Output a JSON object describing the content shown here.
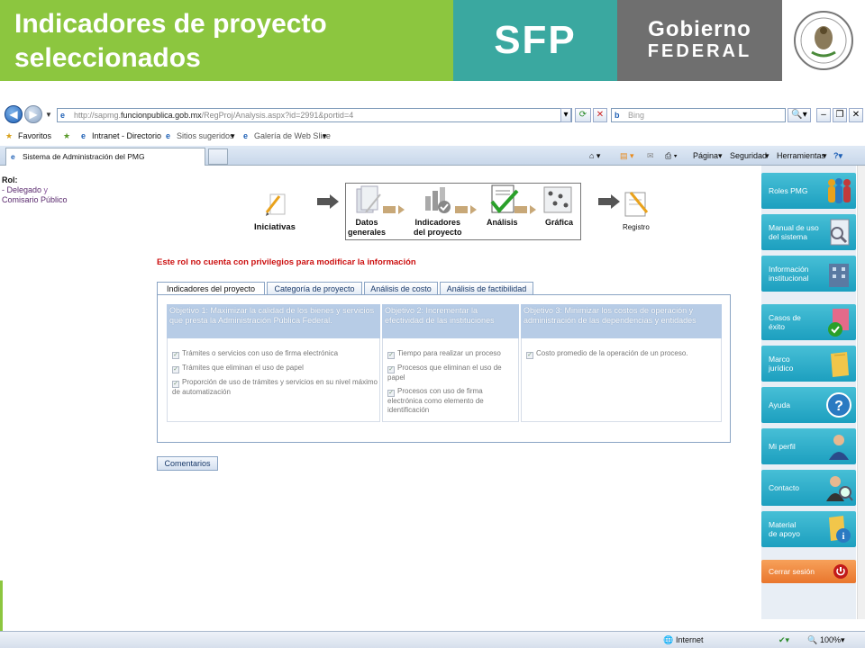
{
  "slide": {
    "title_line1": "Indicadores de proyecto",
    "title_line2": "seleccionados",
    "sfp_logo": "SFP",
    "gob_line1": "Gobierno",
    "gob_line2": "FEDERAL"
  },
  "browser": {
    "url_prefix": "http://sapmg.",
    "url_domain": "funcionpublica.gob.mx",
    "url_path": "/RegProj/Analysis.aspx?id=2991&portid=4",
    "search_placeholder": "Bing",
    "favorites_label": "Favoritos",
    "fav_items": [
      "Intranet - Directorio",
      "Sitios sugeridos",
      "Galería de Web Slice"
    ],
    "tab_title": "Sistema de Administración del PMG",
    "commands": [
      "Página",
      "Seguridad",
      "Herramientas"
    ],
    "status_zone": "Internet",
    "zoom": "100%"
  },
  "role": {
    "label": "Rol:",
    "value_line1": "- Delegado",
    "value_and": "y",
    "value_line2": "Comisario Público"
  },
  "workflow": {
    "steps": [
      {
        "label": "Iniciativas"
      },
      {
        "label": "Datos generales"
      },
      {
        "label": "Indicadores del proyecto"
      },
      {
        "label": "Análisis"
      },
      {
        "label": "Gráfica"
      },
      {
        "label": "Registro"
      }
    ],
    "labels_split": {
      "datos1": "Datos",
      "datos2": "generales",
      "ind1": "Indicadores",
      "ind2": "del proyecto"
    }
  },
  "warning": "Este rol no cuenta con privilegios para modificar la información",
  "tabs": [
    "Indicadores del proyecto",
    "Categoría de proyecto",
    "Análisis de costo",
    "Análisis de factibilidad"
  ],
  "objectives": [
    {
      "title": "Objetivo 1: Maximizar la calidad de los bienes y servicios que presta la Administración Pública Federal.",
      "indicators": [
        "Trámites o servicios con uso de firma electrónica",
        "Trámites que eliminan el uso de papel",
        "Proporción de uso de trámites y servicios en su nivel máximo de automatización"
      ]
    },
    {
      "title": "Objetivo 2: Incrementar la efectividad de las instituciones",
      "indicators": [
        "Tiempo para realizar un proceso",
        "Procesos que eliminan el uso de papel",
        "Procesos con uso de firma electrónica como elemento de identificación"
      ]
    },
    {
      "title": "Objetivo 3: Minimizar los costos de operación y administración de las dependencias y entidades",
      "indicators": [
        "Costo promedio de la operación de un proceso."
      ]
    }
  ],
  "comment_button": "Comentarios",
  "right_menu": {
    "items": [
      {
        "line1": "Roles PMG",
        "line2": ""
      },
      {
        "line1": "Manual de uso",
        "line2": "del sistema"
      },
      {
        "line1": "Información",
        "line2": "institucional"
      },
      {
        "line1": "Casos de",
        "line2": "éxito"
      },
      {
        "line1": "Marco",
        "line2": "jurídico"
      },
      {
        "line1": "Ayuda",
        "line2": ""
      },
      {
        "line1": "Mi perfil",
        "line2": ""
      },
      {
        "line1": "Contacto",
        "line2": ""
      },
      {
        "line1": "Material",
        "line2": "de apoyo"
      }
    ],
    "logout": "Cerrar sesión"
  },
  "colors": {
    "green": "#8cc63f",
    "teal": "#3aa8a0",
    "gray": "#6f6f6f",
    "menu_blue": "#1c9fbf",
    "logout_orange": "#e9762d",
    "warning_red": "#cc1111"
  }
}
